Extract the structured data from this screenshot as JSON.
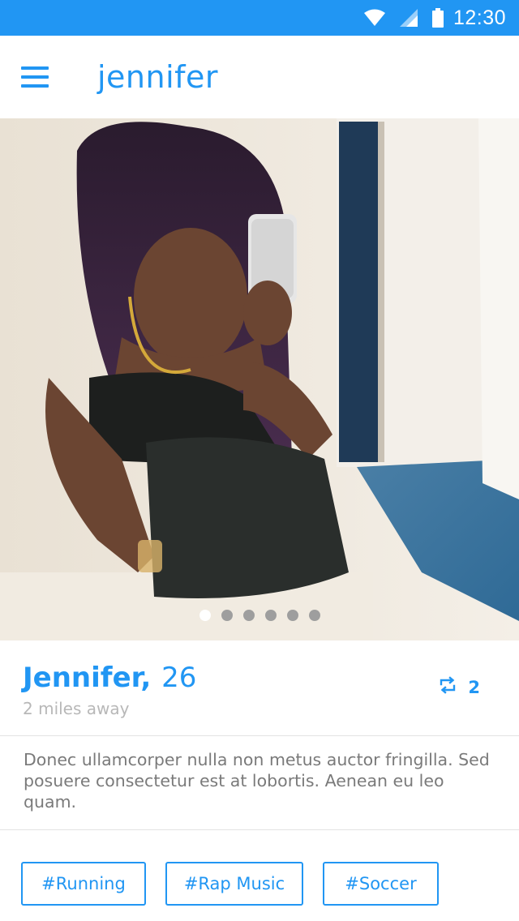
{
  "status_bar": {
    "time": "12:30",
    "icons": [
      "wifi-icon",
      "cell-signal-icon",
      "battery-icon"
    ]
  },
  "app_bar": {
    "title": "jennifer",
    "menu_icon": "hamburger-menu-icon"
  },
  "photo": {
    "description_icon": "profile-photo",
    "total_photos": 6,
    "active_index": 0
  },
  "profile": {
    "name": "Jennifer,",
    "age": "26",
    "distance": "2 miles away",
    "share_icon": "repeat-share-icon",
    "share_count": "2"
  },
  "bio": "Donec ullamcorper nulla non metus auctor fringilla. Sed posuere consectetur est at lobortis. Aenean eu leo quam.",
  "tags": [
    "#Running",
    "#Rap Music",
    "#Soccer"
  ],
  "colors": {
    "accent": "#2196f3",
    "muted_text": "#b8b8b8",
    "body_text": "#7a7a7a"
  }
}
